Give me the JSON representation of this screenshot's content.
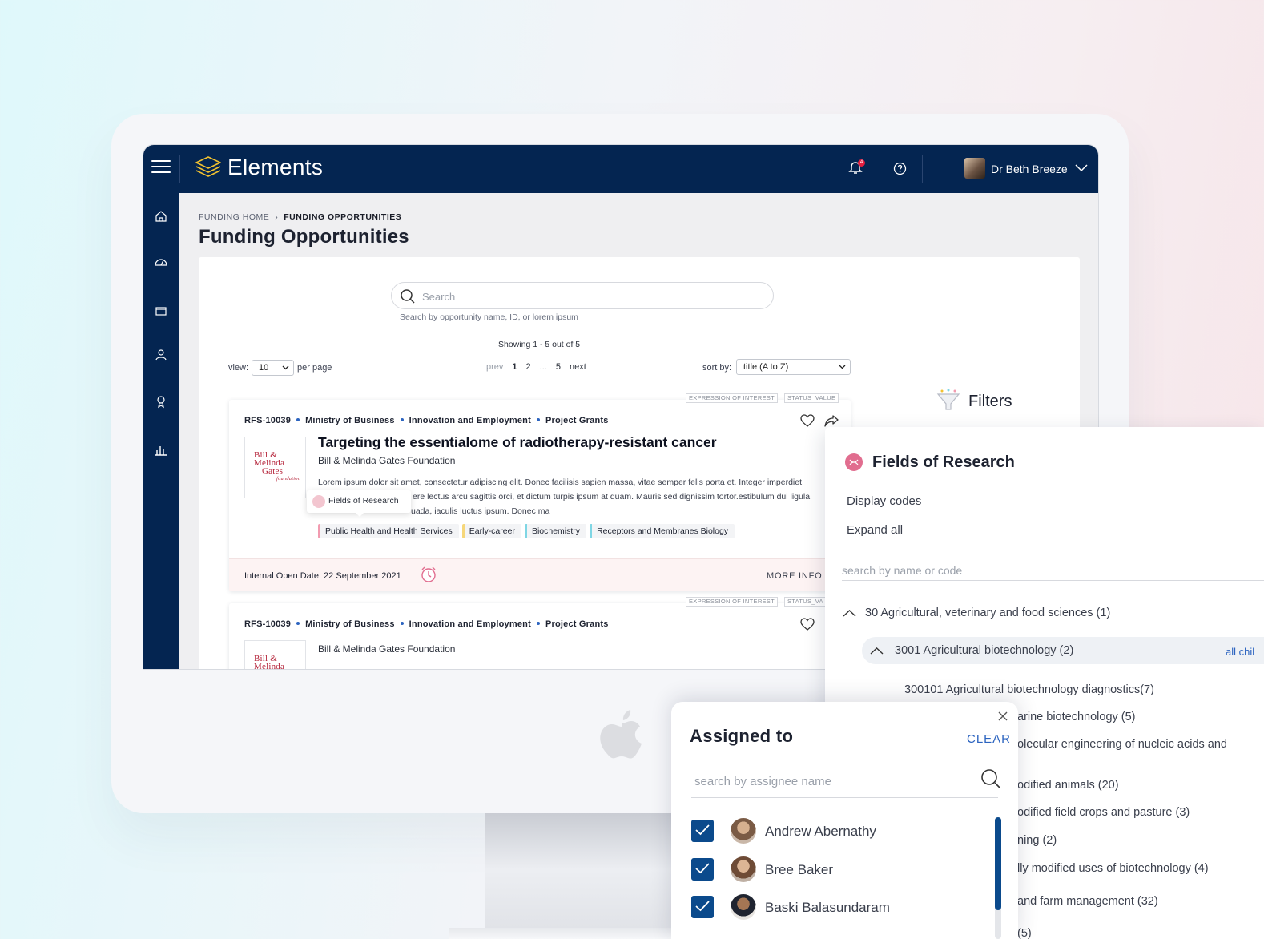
{
  "app": {
    "name": "Elements",
    "notifications_count": "4",
    "user_name": "Dr Beth Breeze"
  },
  "breadcrumb": {
    "home": "FUNDING HOME",
    "current": "FUNDING OPPORTUNITIES"
  },
  "page_title": "Funding Opportunities",
  "search": {
    "placeholder": "Search",
    "hint": "Search by opportunity name, ID, or lorem ipsum"
  },
  "results_summary": "Showing 1 - 5 out of 5",
  "view": {
    "label": "view:",
    "value": "10",
    "suffix": "per page"
  },
  "pagination": {
    "prev": "prev",
    "pages": [
      "1",
      "2",
      "...",
      "5"
    ],
    "next": "next"
  },
  "sort": {
    "label": "sort by:",
    "value": "title (A to Z)"
  },
  "opportunities": [
    {
      "tag_type": "EXPRESSION OF INTEREST",
      "tag_status": "STATUS_VALUE",
      "id": "RFS-10039",
      "funder": "Ministry of Business",
      "program": "Innovation and Employment",
      "scheme": "Project Grants",
      "title": "Targeting the essentialome of radiotherapy-resistant cancer",
      "org": "Bill & Melinda Gates Foundation",
      "logo_lines": [
        "Bill &",
        "Melinda",
        "Gates",
        "foundation"
      ],
      "description": "Lorem ipsum dolor sit amet, consectetur adipiscing elit. Donec facilisis sapien massa, vitae semper felis porta et. Integer imperdiet, ...ere lectus arcu sagittis orci, et dictum turpis ipsum at quam. Mauris sed dignissim tortor.estibulum dui ligula, ...uada, iaculis luctus ipsum. Donec ma",
      "desc_lines": [
        "Lorem ipsum dolor sit amet, consectetur adipiscing elit. Donec facilisis sapien massa, vitae semper felis porta et. Integer imperdiet,",
        "ere lectus arcu sagittis orci, et dictum turpis ipsum at quam. Mauris sed dignissim tortor.estibulum dui ligula,",
        "uada, iaculis luctus ipsum. Donec ma"
      ],
      "tooltip": "Fields of Research",
      "chips": [
        {
          "label": "Public Health and Health Services",
          "color": "#f29bb0"
        },
        {
          "label": "Early-career",
          "color": "#f6d77a"
        },
        {
          "label": "Biochemistry",
          "color": "#7fd6e4"
        },
        {
          "label": "Receptors and Membranes Biology",
          "color": "#7fd6e4"
        }
      ],
      "open_date": "Internal Open Date: 22 September 2021",
      "more_info": "MORE INFO"
    },
    {
      "tag_type": "EXPRESSION OF INTEREST",
      "tag_status": "STATUS_VA",
      "id": "RFS-10039",
      "funder": "Ministry of Business",
      "program": "Innovation and Employment",
      "scheme": "Project Grants",
      "org": "Bill & Melinda Gates Foundation",
      "logo_lines": [
        "Bill &",
        "Melinda"
      ]
    }
  ],
  "filters": {
    "title": "Filters"
  },
  "fields_of_research": {
    "title": "Fields of Research",
    "display_codes": "Display codes",
    "expand_all": "Expand all",
    "search_placeholder": "search by name or code",
    "tree": [
      "30 Agricultural, veterinary and food sciences (1)",
      "3001 Agricultural biotechnology (2)",
      "300101 Agricultural biotechnology diagnostics(7)",
      "arine biotechnology (5)",
      "olecular engineering of nucleic acids and",
      "odified animals (20)",
      "odified field crops and pasture (3)",
      "ning (2)",
      "lly modified uses of biotechnology (4)",
      "and farm management (32)",
      "(5)"
    ],
    "all_children": "all chil"
  },
  "assigned_to": {
    "title": "Assigned to",
    "clear": "CLEAR",
    "search_placeholder": "search by assignee name",
    "people": [
      {
        "name": "Andrew Abernathy",
        "checked": true
      },
      {
        "name": "Bree Baker",
        "checked": true
      },
      {
        "name": "Baski Balasundaram",
        "checked": true
      }
    ]
  },
  "colors": {
    "navy": "#042551",
    "accent_blue": "#2c64c0",
    "checkbox": "#0b4a8c",
    "badge_red": "#e41e3f",
    "logo_gold": "#f2c230"
  }
}
